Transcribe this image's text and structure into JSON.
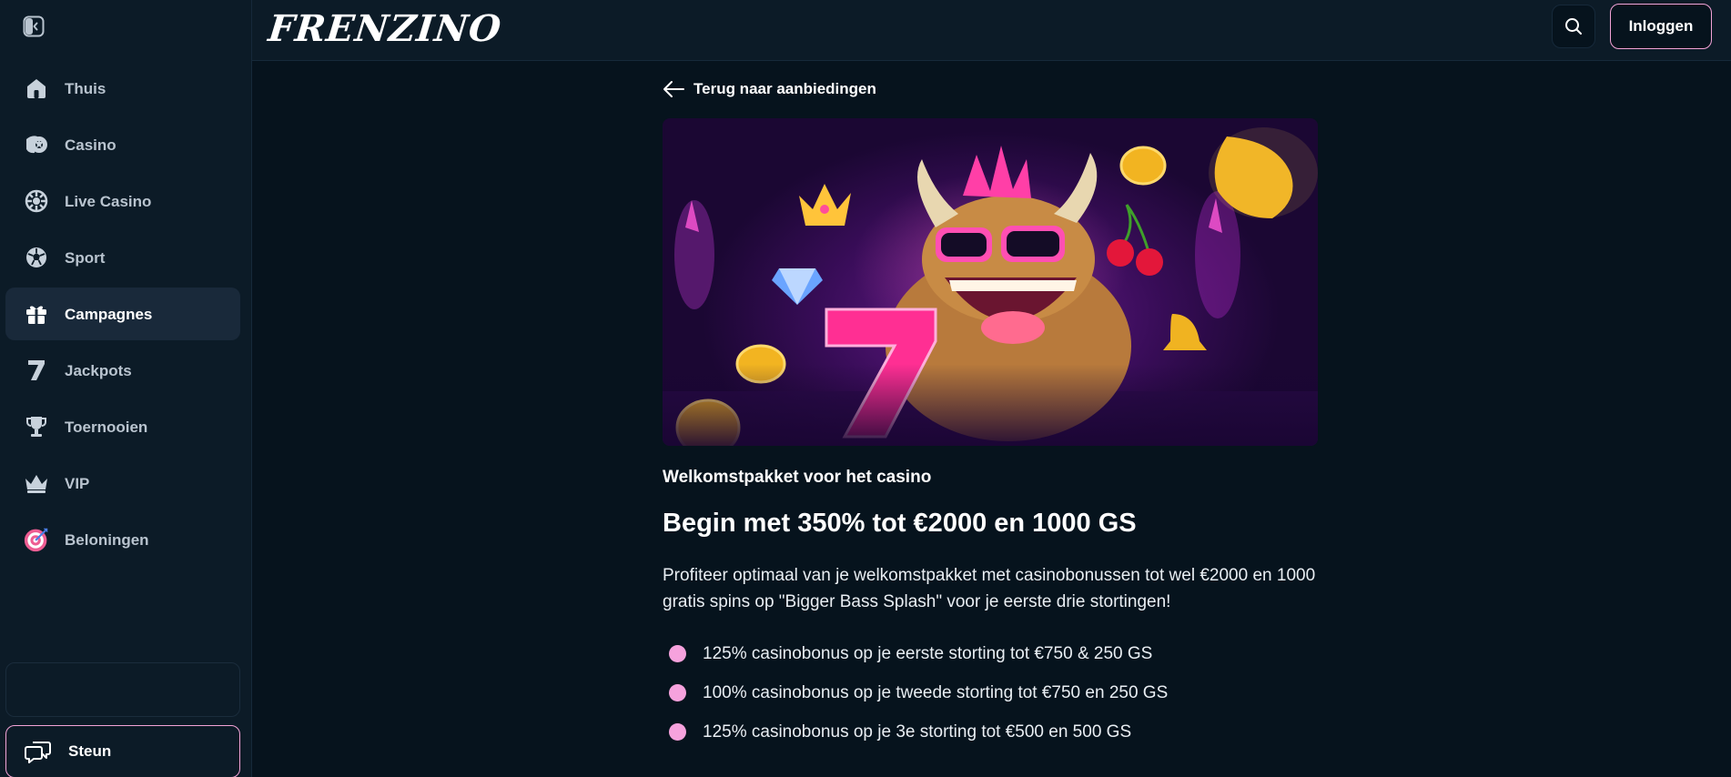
{
  "brand": {
    "logo_text": "FRENZINO",
    "accent": "#f3a3d7",
    "bullet_color": "#f6a2dd"
  },
  "sidebar": {
    "items": [
      {
        "label": "Thuis",
        "icon": "home-icon"
      },
      {
        "label": "Casino",
        "icon": "casino-chip-icon"
      },
      {
        "label": "Live Casino",
        "icon": "roulette-icon"
      },
      {
        "label": "Sport",
        "icon": "soccer-ball-icon"
      },
      {
        "label": "Campagnes",
        "icon": "gift-icon",
        "active": true
      },
      {
        "label": "Jackpots",
        "icon": "seven-icon"
      },
      {
        "label": "Toernooien",
        "icon": "trophy-icon"
      },
      {
        "label": "VIP",
        "icon": "crown-icon"
      },
      {
        "label": "Beloningen",
        "icon": "target-icon"
      }
    ],
    "support_label": "Steun"
  },
  "header": {
    "search_icon": "search-icon",
    "login_label": "Inloggen"
  },
  "main": {
    "back_label": "Terug naar aanbiedingen",
    "kicker": "Welkomstpakket voor het casino",
    "title": "Begin met 350% tot €2000 en 1000 GS",
    "description": "Profiteer optimaal van je welkomstpakket met casinobonussen tot wel €2000 en 1000 gratis spins op \"Bigger Bass Splash\" voor je eerste drie stortingen!",
    "bullets": [
      "125% casinobonus op je eerste storting tot €750 & 250 GS",
      "100% casinobonus op je tweede storting tot €750 en 250 GS",
      "125% casinobonus op je 3e storting tot €500 en 500 GS"
    ]
  }
}
